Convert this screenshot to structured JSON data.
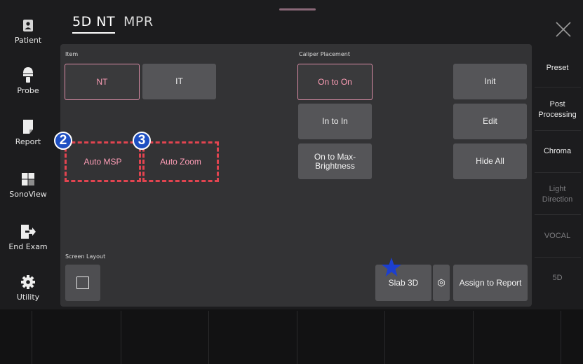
{
  "sidebar": {
    "items": [
      {
        "label": "Patient"
      },
      {
        "label": "Probe"
      },
      {
        "label": "Report"
      },
      {
        "label": "SonoView"
      },
      {
        "label": "End Exam"
      },
      {
        "label": "Utility"
      }
    ]
  },
  "tabs": [
    {
      "label": "5D NT",
      "active": true
    },
    {
      "label": "MPR",
      "active": false
    }
  ],
  "panel": {
    "item_label": "Item",
    "item_buttons": [
      {
        "label": "NT",
        "selected": true
      },
      {
        "label": "IT",
        "selected": false
      }
    ],
    "auto_msp_label": "Auto MSP",
    "auto_zoom_label": "Auto Zoom",
    "badge_2": "2",
    "badge_3": "3",
    "caliper_label": "Caliper Placement",
    "caliper_buttons": [
      {
        "label": "On to On",
        "selected": true
      },
      {
        "label": "In to In",
        "selected": false
      },
      {
        "label": "On to Max-\nBrightness",
        "selected": false
      }
    ],
    "action_buttons": [
      {
        "label": "Init"
      },
      {
        "label": "Edit"
      },
      {
        "label": "Hide All"
      }
    ],
    "screen_layout_label": "Screen Layout",
    "slab3d_label": "Slab 3D",
    "assign_label": "Assign to Report"
  },
  "right_menu": {
    "items": [
      {
        "label": "Preset",
        "enabled": true
      },
      {
        "label": "Post\nProcessing",
        "enabled": true
      },
      {
        "label": "Chroma",
        "enabled": true
      },
      {
        "label": "Light\nDirection",
        "enabled": false
      },
      {
        "label": "VOCAL",
        "enabled": false
      },
      {
        "label": "5D",
        "enabled": false
      }
    ]
  },
  "colors": {
    "accent_pink": "#ff9eb7",
    "annotation_red": "#e24450",
    "badge_blue": "#1e4fc2",
    "star_blue": "#1c3fd0"
  }
}
